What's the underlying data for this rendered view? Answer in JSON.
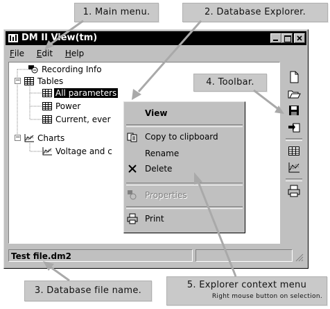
{
  "callouts": {
    "main_menu": "1. Main menu.",
    "db_explorer": "2. Database Explorer.",
    "db_file": "3. Database file name.",
    "toolbar": "4. Toolbar.",
    "context_title": "5. Explorer context menu",
    "context_sub": "Right mouse button on selection."
  },
  "window": {
    "title": "DM II View(tm)",
    "menu": [
      {
        "label": "File",
        "key": "F",
        "rest": "ile"
      },
      {
        "label": "Edit",
        "key": "E",
        "rest": "dit"
      },
      {
        "label": "Help",
        "key": "H",
        "rest": "elp"
      }
    ]
  },
  "tree": {
    "recording": "Recording Info",
    "tables": "Tables",
    "all_params": "All parameters",
    "power": "Power",
    "current": "Current, ever",
    "charts": "Charts",
    "voltage": "Voltage and c"
  },
  "context_menu": {
    "view": "View",
    "copy": "Copy to clipboard",
    "rename": "Rename",
    "delete": "Delete",
    "properties": "Properties",
    "print": "Print"
  },
  "status": {
    "file": "Test file.dm2"
  },
  "colors": {
    "titlebar": "#000000",
    "face": "#c0c0c0",
    "callout": "#c9c9c9",
    "arrow": "#a9a9a9"
  }
}
